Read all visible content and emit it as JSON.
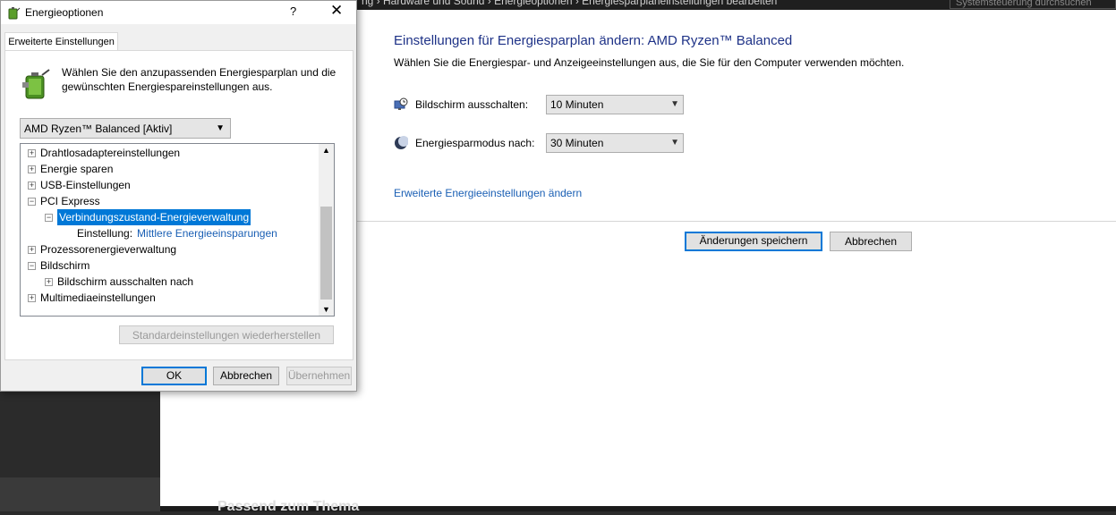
{
  "background": {
    "breadcrumb": "ng   ›   Hardware und Sound   ›   Energieoptionen   ›   Energiesparplaneinstellungen bearbeiten",
    "search_placeholder": "Systemsteuerung durchsuchen",
    "bottom_clip_text": "Passend zum Thema"
  },
  "control_panel": {
    "title": "Einstellungen für Energiesparplan ändern: AMD Ryzen™ Balanced",
    "subtitle": "Wählen Sie die Energiespar- und Anzeigeeinstellungen aus, die Sie für den Computer verwenden möchten.",
    "display_off_label": "Bildschirm ausschalten:",
    "display_off_value": "10 Minuten",
    "sleep_label": "Energiesparmodus nach:",
    "sleep_value": "30 Minuten",
    "advanced_link": "Erweiterte Energieeinstellungen ändern",
    "save_button": "Änderungen speichern",
    "cancel_button": "Abbrechen"
  },
  "dialog": {
    "title": "Energieoptionen",
    "help_glyph": "?",
    "close_glyph": "✕",
    "tab": "Erweiterte Einstellungen",
    "intro": "Wählen Sie den anzupassenden Energiesparplan und die gewünschten Energiespareinstellungen aus.",
    "plan_selected": "AMD Ryzen™ Balanced [Aktiv]",
    "tree": [
      {
        "label": "Drahtlosadaptereinstellungen",
        "expander": "+"
      },
      {
        "label": "Energie sparen",
        "expander": "+"
      },
      {
        "label": "USB-Einstellungen",
        "expander": "+"
      },
      {
        "label": "PCI Express",
        "expander": "−"
      },
      {
        "label": "Verbindungszustand-Energieverwaltung",
        "expander": "−"
      },
      {
        "label": "Einstellung:",
        "value": "Mittlere Energieeinsparungen"
      },
      {
        "label": "Prozessorenergieverwaltung",
        "expander": "+"
      },
      {
        "label": "Bildschirm",
        "expander": "−"
      },
      {
        "label": "Bildschirm ausschalten nach",
        "expander": "+"
      },
      {
        "label": "Multimediaeinstellungen",
        "expander": "+"
      }
    ],
    "restore_button": "Standardeinstellungen wiederherstellen",
    "ok_button": "OK",
    "cancel_button": "Abbrechen",
    "apply_button": "Übernehmen"
  },
  "colors": {
    "selection": "#0078d7",
    "link": "#1a5fb4",
    "title_blue": "#1e3287"
  },
  "icons": [
    "battery-plug-icon",
    "monitor-clock-icon",
    "moon-icon",
    "chevron-down-icon",
    "close-icon",
    "help-icon"
  ]
}
